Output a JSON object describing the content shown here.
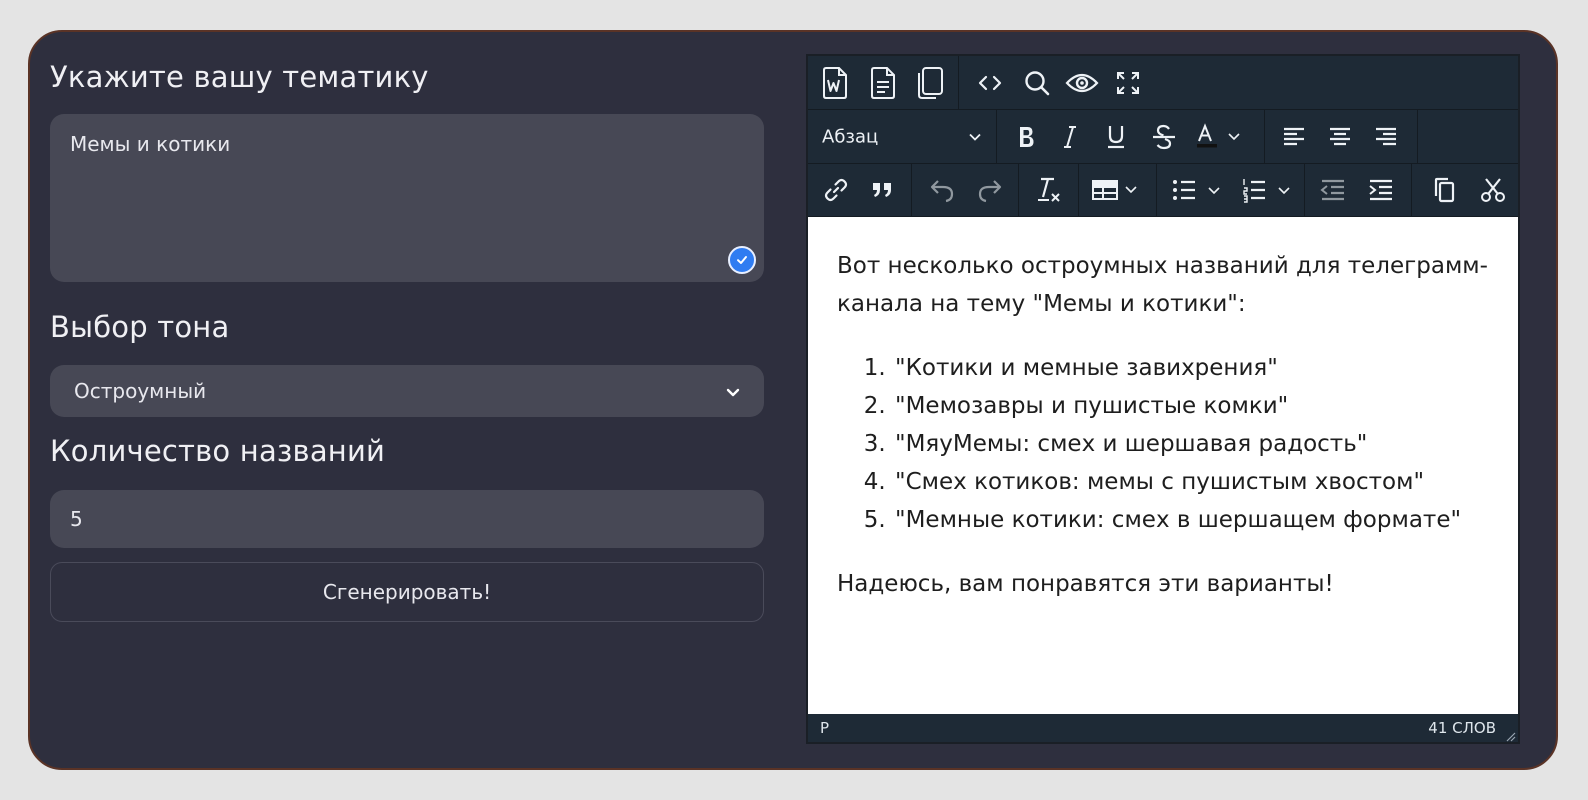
{
  "form": {
    "topic_label": "Укажите вашу тематику",
    "topic_value": "Мемы и котики",
    "tone_label": "Выбор тона",
    "tone_value": "Остроумный",
    "count_label": "Количество названий",
    "count_value": "5",
    "generate_label": "Сгенерировать!"
  },
  "editor": {
    "toolbar": {
      "paragraph_format": "Абзац",
      "icons": [
        "word-export-icon",
        "document-icon",
        "copy-pages-icon",
        "source-code-icon",
        "search-icon",
        "preview-icon",
        "fullscreen-icon",
        "bold-icon",
        "italic-icon",
        "underline-icon",
        "strikethrough-icon",
        "text-color-icon",
        "align-left-icon",
        "align-center-icon",
        "align-right-icon",
        "link-icon",
        "blockquote-icon",
        "undo-icon",
        "redo-icon",
        "clear-format-icon",
        "table-icon",
        "bullet-list-icon",
        "numbered-list-icon",
        "outdent-icon",
        "indent-icon",
        "copy-icon",
        "cut-icon"
      ]
    },
    "content": {
      "intro": "Вот несколько остроумных названий для телеграмм-канала на тему \"Мемы и котики\":",
      "items": [
        "\"Котики и мемные завихрения\"",
        "\"Мемозавры и пушистые комки\"",
        "\"МяуМемы: смех и шершавая радость\"",
        "\"Смех котиков: мемы с пушистым хвостом\"",
        "\"Мемные котики: смех в шершащем формате\""
      ],
      "outro": "Надеюсь, вам понравятся эти варианты!"
    },
    "status": {
      "path": "P",
      "word_count": "41 СЛОВ"
    }
  },
  "colors": {
    "page_bg": "#e4e4e4",
    "card_bg": "#2e2f3e",
    "card_border": "#5a3326",
    "field_bg": "#474855",
    "toolbar_bg": "#1e2a36",
    "accent": "#2f7cf1"
  }
}
